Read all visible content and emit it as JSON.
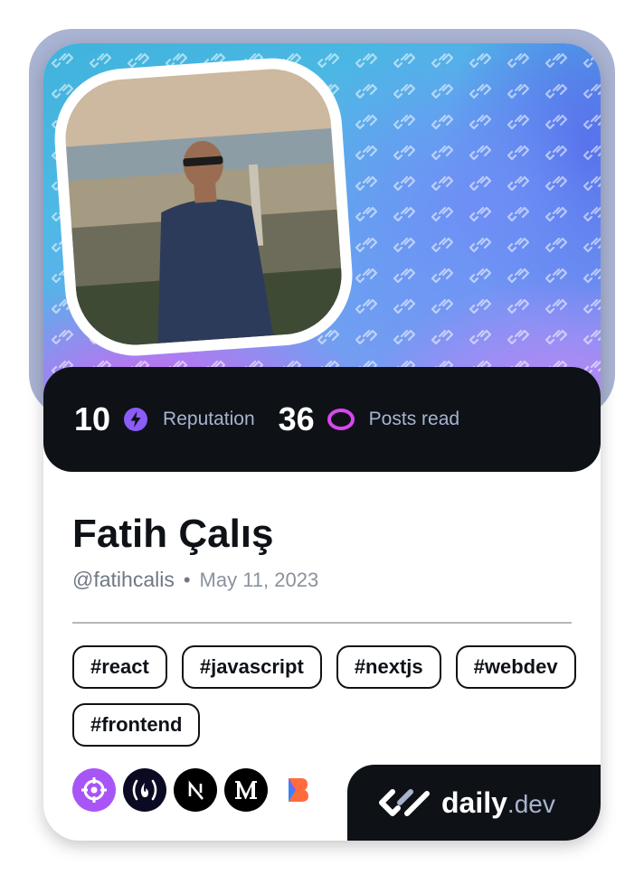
{
  "profile": {
    "name": "Fatih Çalış",
    "handle": "@fatihcalis",
    "separator": "•",
    "joined": "May 11, 2023"
  },
  "stats": {
    "reputation_value": "10",
    "reputation_label": "Reputation",
    "posts_value": "36",
    "posts_label": "Posts read"
  },
  "tags": [
    "#react",
    "#javascript",
    "#nextjs",
    "#webdev",
    "#frontend"
  ],
  "sources": [
    {
      "icon": "crosshair-icon",
      "color": "#a855f7"
    },
    {
      "icon": "freecodecamp-icon",
      "color": "#0a0a23"
    },
    {
      "icon": "nextjs-icon",
      "color": "#000000"
    },
    {
      "icon": "medium-icon",
      "color": "#000000"
    },
    {
      "icon": "bold-b-icon",
      "color": "#ff6b3d"
    }
  ],
  "brand": {
    "name": "daily",
    "suffix": ".dev"
  },
  "colors": {
    "card_dark": "#0e1217",
    "reputation_icon": "#8b5cf6",
    "posts_icon": "#d946ef",
    "frame": "#a9b3d2"
  }
}
